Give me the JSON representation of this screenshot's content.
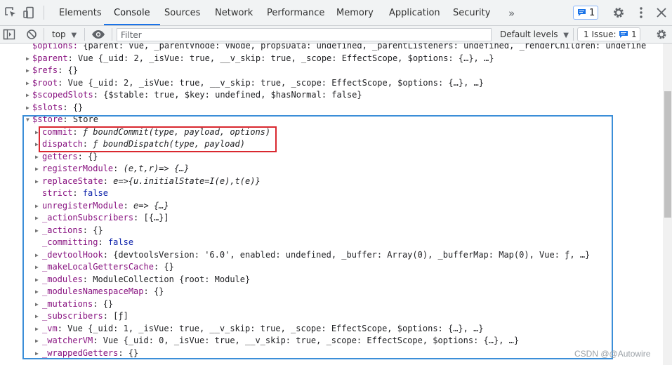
{
  "tabs": [
    {
      "label": "Elements",
      "active": false
    },
    {
      "label": "Console",
      "active": true
    },
    {
      "label": "Sources",
      "active": false
    },
    {
      "label": "Network",
      "active": false
    },
    {
      "label": "Performance",
      "active": false
    },
    {
      "label": "Memory",
      "active": false
    },
    {
      "label": "Application",
      "active": false
    },
    {
      "label": "Security",
      "active": false
    }
  ],
  "tabbar": {
    "more_label": "»",
    "messages_count": "1"
  },
  "toolbar": {
    "context_label": "top",
    "filter_placeholder": "Filter",
    "levels_label": "Default levels",
    "issues_label": "1 Issue:",
    "issues_count": "1"
  },
  "console": {
    "lines": [
      {
        "prefix": "$options: ",
        "value": "{parent: Vue, _parentVnode: VNode, propsData: undefined, _parentListeners: undefined, _renderChildren: undefine"
      },
      {
        "key": "$parent",
        "value": "Vue {_uid: 2, _isVue: true, __v_skip: true, _scope: EffectScope, $options: {…}, …}"
      },
      {
        "key": "$refs",
        "value": "{}"
      },
      {
        "key": "$root",
        "value": "Vue {_uid: 2, _isVue: true, __v_skip: true, _scope: EffectScope, $options: {…}, …}"
      },
      {
        "key": "$scopedSlots",
        "value": "{$stable: true, $key: undefined, $hasNormal: false}"
      },
      {
        "key": "$slots",
        "value": "{}"
      },
      {
        "key": "$store",
        "value": "Store"
      },
      {
        "key": "commit",
        "value": "ƒ boundCommit(type, payload, options)"
      },
      {
        "key": "dispatch",
        "value": "ƒ boundDispatch(type, payload)"
      },
      {
        "key": "getters",
        "value": "{}"
      },
      {
        "key": "registerModule",
        "value": "(e,t,r)=> {…}"
      },
      {
        "key": "replaceState",
        "value": "e=>{u.initialState=I(e),t(e)}"
      },
      {
        "key": "strict",
        "value": "false"
      },
      {
        "key": "unregisterModule",
        "value": "e=> {…}"
      },
      {
        "key": "_actionSubscribers",
        "value": "[{…}]"
      },
      {
        "key": "_actions",
        "value": "{}"
      },
      {
        "key": "_committing",
        "value": "false"
      },
      {
        "key": "_devtoolHook",
        "value": "{devtoolsVersion: '6.0', enabled: undefined, _buffer: Array(0), _bufferMap: Map(0), Vue: ƒ, …}"
      },
      {
        "key": "_makeLocalGettersCache",
        "value": "{}"
      },
      {
        "key": "_modules",
        "value": "ModuleCollection {root: Module}"
      },
      {
        "key": "_modulesNamespaceMap",
        "value": "{}"
      },
      {
        "key": "_mutations",
        "value": "{}"
      },
      {
        "key": "_subscribers",
        "value": "[ƒ]"
      },
      {
        "key": "_vm",
        "value": "Vue {_uid: 1, _isVue: true, __v_skip: true, _scope: EffectScope, $options: {…}, …}"
      },
      {
        "key": "_watcherVM",
        "value": "Vue {_uid: 0, _isVue: true, __v_skip: true, _scope: EffectScope, $options: {…}, …}"
      },
      {
        "key": "_wrappedGetters",
        "value": "{}"
      }
    ]
  },
  "watermark": "CSDN @@Autowire"
}
